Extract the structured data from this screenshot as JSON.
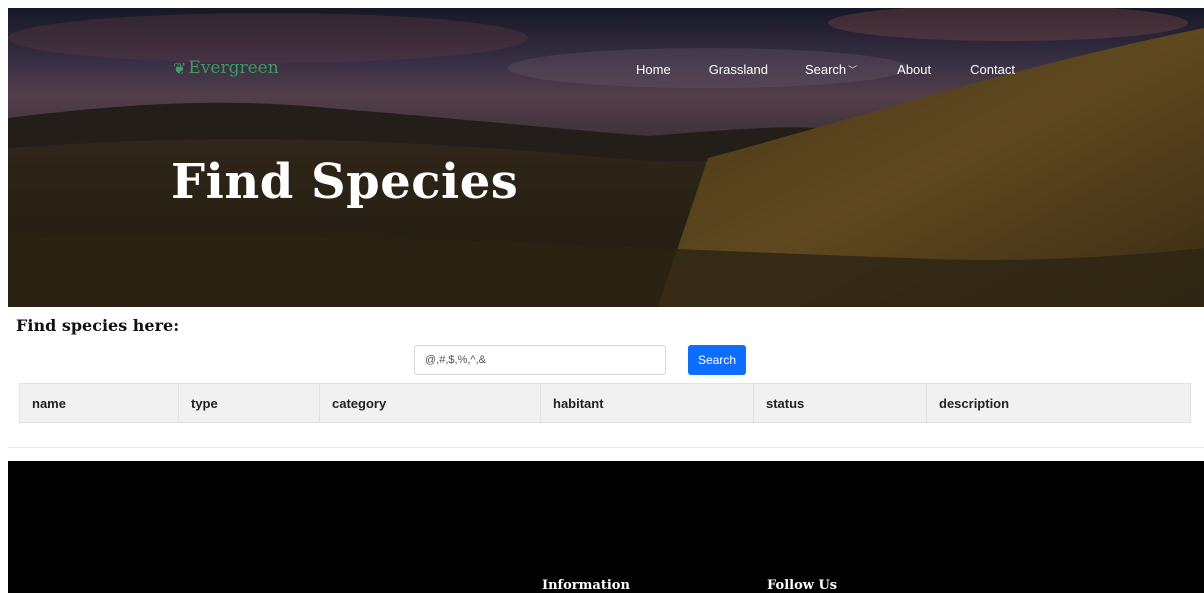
{
  "brand": {
    "icon": "leaf-icon",
    "name": "Evergreen",
    "color": "#3f9b63"
  },
  "nav": {
    "items": [
      {
        "label": "Home"
      },
      {
        "label": "Grassland"
      },
      {
        "label": "Search",
        "has_dropdown": true,
        "dropdown_icon": "chevron-down-icon"
      },
      {
        "label": "About"
      },
      {
        "label": "Contact"
      }
    ]
  },
  "hero": {
    "title": "Find Species"
  },
  "search": {
    "heading": "Find species here:",
    "placeholder": "@,#,$,%,^,&",
    "value": "",
    "button_label": "Search",
    "button_color": "#0d6efd"
  },
  "table": {
    "columns": [
      "name",
      "type",
      "category",
      "habitant",
      "status",
      "description"
    ],
    "rows": []
  },
  "footer": {
    "headings": [
      "Information",
      "Follow Us"
    ]
  }
}
